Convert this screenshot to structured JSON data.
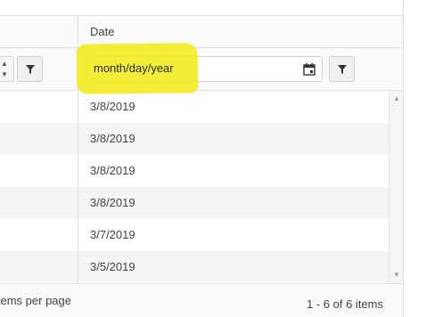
{
  "header": {
    "date_column_title": "Date"
  },
  "filter": {
    "date_placeholder": "month/day/year",
    "calendar_icon": "calendar-icon",
    "filter_icon": "filter-icon"
  },
  "rows": [
    {
      "date": "3/8/2019"
    },
    {
      "date": "3/8/2019"
    },
    {
      "date": "3/8/2019"
    },
    {
      "date": "3/8/2019"
    },
    {
      "date": "3/7/2019"
    },
    {
      "date": "3/5/2019"
    }
  ],
  "pager": {
    "page_size_label": "items per page",
    "info": "1 - 6 of 6 items"
  },
  "colors": {
    "highlight": "#f2ea1a",
    "alt_row": "#f4f4f4",
    "border": "#e0e0e0"
  }
}
